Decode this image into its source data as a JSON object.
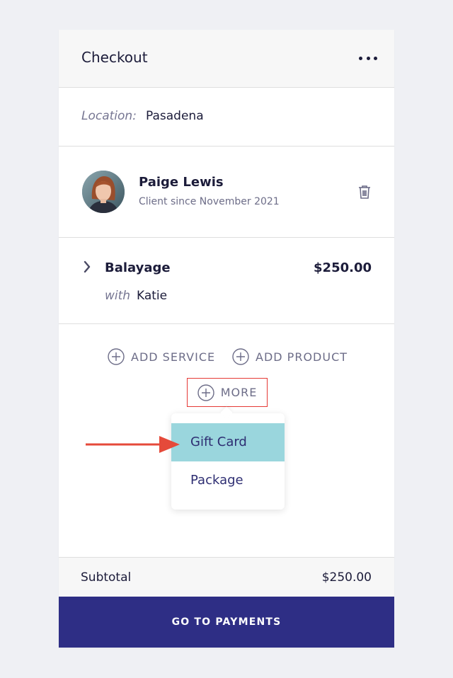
{
  "header": {
    "title": "Checkout",
    "menu_icon": "more-horizontal-icon"
  },
  "location": {
    "label": "Location:",
    "value": "Pasadena"
  },
  "client": {
    "name": "Paige Lewis",
    "since": "Client since November 2021",
    "delete_icon": "trash-icon"
  },
  "service": {
    "name": "Balayage",
    "price": "$250.00",
    "with_label": "with",
    "staff": "Katie"
  },
  "actions": {
    "add_service": "ADD SERVICE",
    "add_product": "ADD PRODUCT",
    "more": "MORE"
  },
  "more_menu": {
    "items": [
      {
        "label": "Gift Card",
        "selected": true
      },
      {
        "label": "Package",
        "selected": false
      }
    ]
  },
  "summary": {
    "subtotal_label": "Subtotal",
    "subtotal_value": "$250.00"
  },
  "footer": {
    "button_label": "GO TO PAYMENTS"
  },
  "colors": {
    "accent": "#2e2e85",
    "highlight": "#9ad6dd",
    "annotation": "#e53935"
  }
}
